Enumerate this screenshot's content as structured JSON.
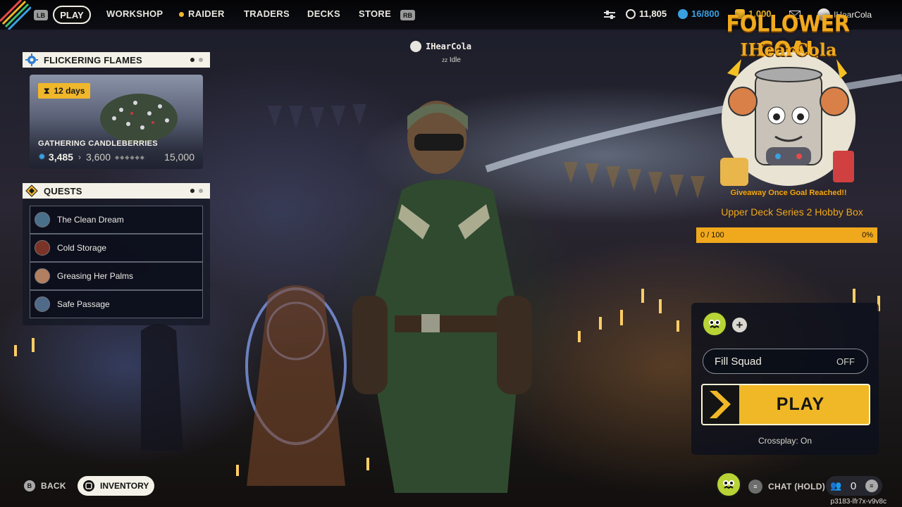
{
  "nav": {
    "left_bumper": "LB",
    "right_bumper": "RB",
    "tabs": [
      {
        "label": "PLAY",
        "active": true
      },
      {
        "label": "WORKSHOP"
      },
      {
        "label": "RAIDER"
      },
      {
        "label": "TRADERS"
      },
      {
        "label": "DECKS"
      },
      {
        "label": "STORE"
      }
    ],
    "currencies": [
      {
        "icon": "coins-icon",
        "value": "11,805"
      },
      {
        "icon": "raider-token-icon",
        "value": "16/800",
        "color": "#3aa0e0"
      },
      {
        "icon": "cred-icon",
        "value": "1,000"
      }
    ],
    "username": "IHearCola"
  },
  "event": {
    "title": "FLICKERING FLAMES",
    "timer": "12  days",
    "name": "GATHERING CANDLEBERRIES",
    "current": "3,485",
    "next": "3,600",
    "max": "15,000",
    "progress_fraction": 0.23
  },
  "quests": {
    "title": "QUESTS",
    "items": [
      {
        "label": "The Clean Dream",
        "color": "#4a6f8a"
      },
      {
        "label": "Cold Storage",
        "color": "#7a3326"
      },
      {
        "label": "Greasing Her Palms",
        "color": "#b08060"
      },
      {
        "label": "Safe Passage",
        "color": "#506a8a"
      }
    ]
  },
  "player": {
    "name": "IHearCola",
    "status": "Idle"
  },
  "goal": {
    "title": "FOLLOWER GOAL",
    "streamer": "IHearCola",
    "banner": "Giveaway Once Goal Reached!!",
    "subtitle": "Upper Deck Series 2 Hobby Box",
    "progress_text": "0 / 100",
    "percent_text": "0%",
    "progress_fraction": 0,
    "accent": "#f0a81c"
  },
  "squad": {
    "fill_label": "Fill Squad",
    "fill_value": "OFF",
    "play_label": "PLAY",
    "crossplay": "Crossplay: On"
  },
  "bottom": {
    "back_button": "B",
    "back_label": "BACK",
    "inventory_label": "INVENTORY",
    "chat_label": "CHAT (HOLD)",
    "party_count": "0",
    "session_id": "p3183-lfr7x-v9v8c"
  }
}
